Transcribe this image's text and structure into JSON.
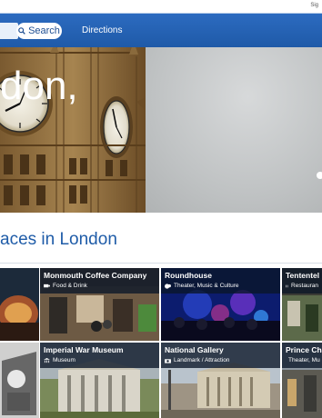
{
  "header": {
    "signin_label": "Sig",
    "search_label": "Search",
    "directions_label": "Directions"
  },
  "hero": {
    "title": "don,"
  },
  "section": {
    "title": "aces in London"
  },
  "places": [
    {
      "name": "Monmouth Coffee Company",
      "category": "Food & Drink",
      "icon": "food-icon"
    },
    {
      "name": "Roundhouse",
      "category": "Theater, Music & Culture",
      "icon": "theater-icon"
    },
    {
      "name": "Tententel",
      "category": "Restauran",
      "icon": "restaurant-icon"
    },
    {
      "name": "Imperial War Museum",
      "category": "Museum",
      "icon": "museum-icon"
    },
    {
      "name": "National Gallery",
      "category": "Landmark / Attraction",
      "icon": "camera-icon"
    },
    {
      "name": "Prince Cha",
      "category": "Theater, Mu",
      "icon": "camera-icon"
    }
  ],
  "colors": {
    "nav_blue": "#1f5aa8",
    "section_title": "#1f5ca8",
    "tile_label_bg": "#0a1628"
  }
}
